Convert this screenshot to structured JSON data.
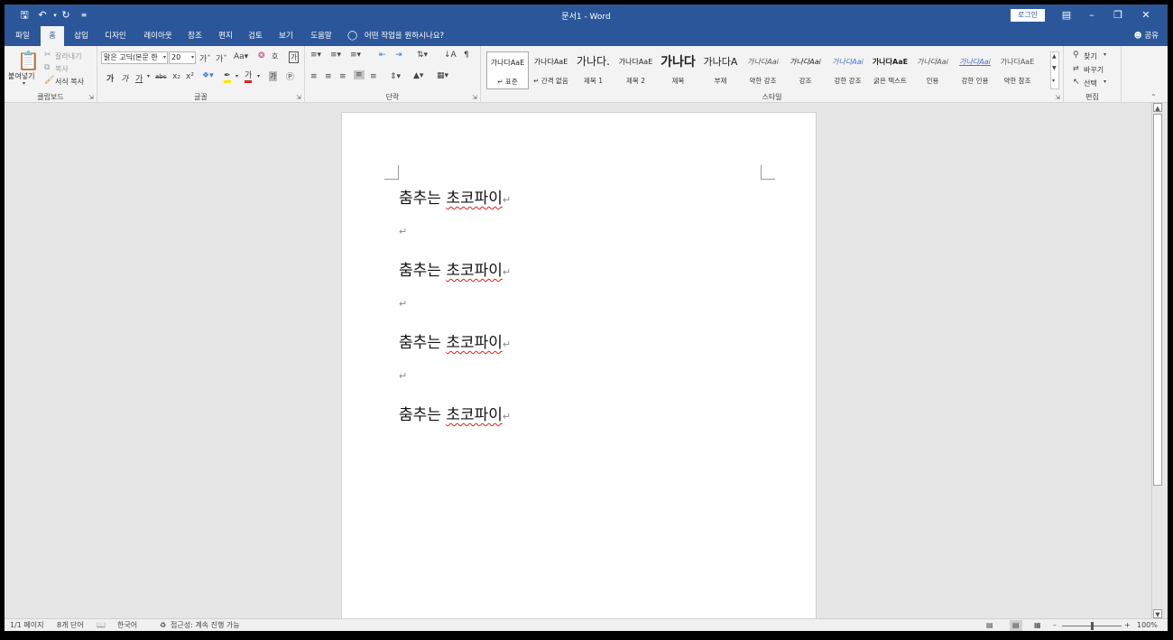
{
  "window": {
    "title": "문서1  -  Word",
    "login": "로그인"
  },
  "quick_access": [
    "save-icon",
    "undo-icon",
    "redo-icon",
    "customize-icon"
  ],
  "tabs": [
    {
      "label": "파일",
      "active": false
    },
    {
      "label": "홈",
      "active": true
    },
    {
      "label": "삽입",
      "active": false
    },
    {
      "label": "디자인",
      "active": false
    },
    {
      "label": "레이아웃",
      "active": false
    },
    {
      "label": "참조",
      "active": false
    },
    {
      "label": "편지",
      "active": false
    },
    {
      "label": "검토",
      "active": false
    },
    {
      "label": "보기",
      "active": false
    },
    {
      "label": "도움말",
      "active": false
    }
  ],
  "tell_me": "어떤 작업을 원하시나요?",
  "share": "공유",
  "clipboard": {
    "label": "클립보드",
    "paste": "붙여넣기",
    "cut": "잘라내기",
    "copy": "복사",
    "format_painter": "서식 복사"
  },
  "font": {
    "label": "글꼴",
    "name": "맑은 고딕(본문 한",
    "size": "20"
  },
  "paragraph": {
    "label": "단락"
  },
  "styles": {
    "label": "스타일",
    "items": [
      {
        "preview": "가나다AaE",
        "name": "표준",
        "selected": true
      },
      {
        "preview": "가나다AaE",
        "name": "간격 없음",
        "selected": false
      },
      {
        "preview": "가나다.",
        "name": "제목 1",
        "selected": false
      },
      {
        "preview": "가나다AaE",
        "name": "제목 2",
        "selected": false
      },
      {
        "preview": "가나다",
        "name": "제목",
        "selected": false
      },
      {
        "preview": "가나다A",
        "name": "부제",
        "selected": false
      },
      {
        "preview": "가나다Aai",
        "name": "약한 강조",
        "selected": false
      },
      {
        "preview": "가나다Aai",
        "name": "강조",
        "selected": false
      },
      {
        "preview": "가나다Aai",
        "name": "강한 강조",
        "selected": false
      },
      {
        "preview": "가나다AaE",
        "name": "굵은 텍스트",
        "selected": false
      },
      {
        "preview": "가나다Aai",
        "name": "인용",
        "selected": false
      },
      {
        "preview": "가나다Aai",
        "name": "강한 인용",
        "selected": false
      },
      {
        "preview": "가나다AaE",
        "name": "약한 참조",
        "selected": false
      }
    ]
  },
  "editing": {
    "label": "편집",
    "find": "찾기",
    "replace": "바꾸기",
    "select": "선택"
  },
  "document": {
    "paragraphs": [
      {
        "plain": "춤추는 ",
        "underlined": "초코파이"
      },
      {
        "plain": "",
        "underlined": ""
      },
      {
        "plain": "춤추는 ",
        "underlined": "초코파이"
      },
      {
        "plain": "",
        "underlined": ""
      },
      {
        "plain": "춤추는 ",
        "underlined": "초코파이"
      },
      {
        "plain": "",
        "underlined": ""
      },
      {
        "plain": "춤추는 ",
        "underlined": "초코파이"
      }
    ]
  },
  "status": {
    "page": "1/1 페이지",
    "words": "8개 단어",
    "language": "한국어",
    "accessibility": "접근성: 계속 진행 가능",
    "zoom": "100%"
  },
  "colors": {
    "accent": "#2b579a",
    "spell_error": "#e02020"
  }
}
